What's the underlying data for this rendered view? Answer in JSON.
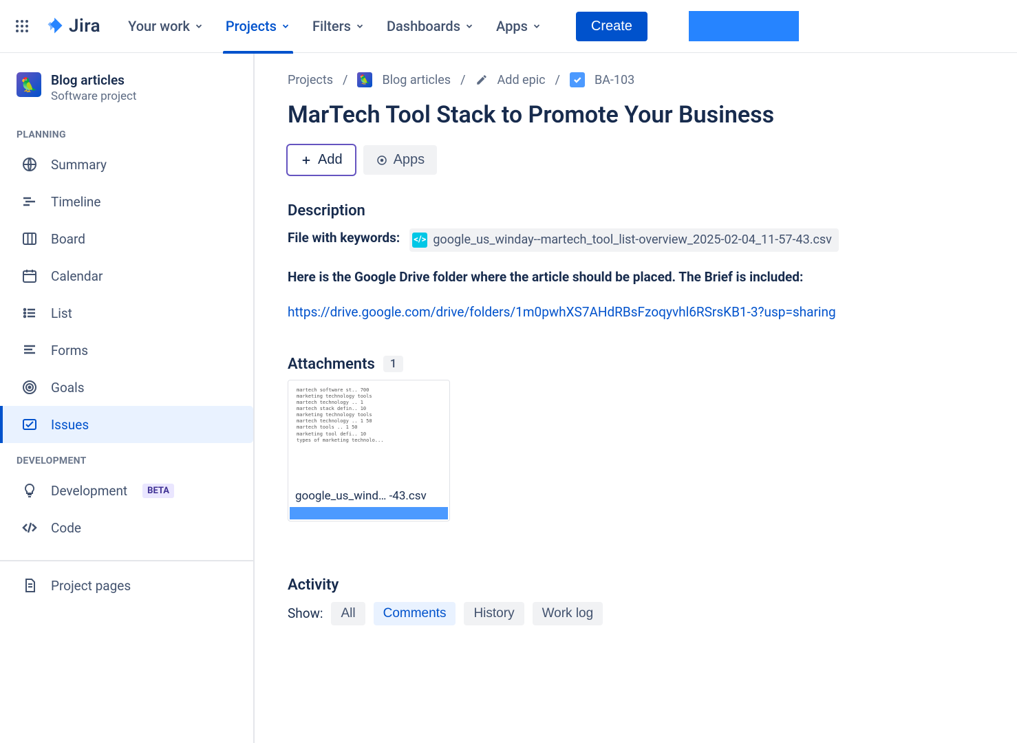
{
  "brand": {
    "name": "Jira"
  },
  "topnav": {
    "items": [
      {
        "label": "Your work"
      },
      {
        "label": "Projects"
      },
      {
        "label": "Filters"
      },
      {
        "label": "Dashboards"
      },
      {
        "label": "Apps"
      }
    ],
    "create": "Create"
  },
  "project": {
    "name": "Blog articles",
    "type": "Software project"
  },
  "sidebar": {
    "sections": {
      "planning": "PLANNING",
      "development": "DEVELOPMENT"
    },
    "planning": [
      {
        "label": "Summary"
      },
      {
        "label": "Timeline"
      },
      {
        "label": "Board"
      },
      {
        "label": "Calendar"
      },
      {
        "label": "List"
      },
      {
        "label": "Forms"
      },
      {
        "label": "Goals"
      },
      {
        "label": "Issues"
      }
    ],
    "development": [
      {
        "label": "Development",
        "badge": "BETA"
      },
      {
        "label": "Code"
      }
    ],
    "project_pages": "Project pages"
  },
  "breadcrumbs": {
    "root": "Projects",
    "project": "Blog articles",
    "epic": "Add epic",
    "key": "BA-103"
  },
  "issue": {
    "title": "MarTech Tool Stack to Promote Your Business",
    "actions": {
      "add": "Add",
      "apps": "Apps"
    }
  },
  "description": {
    "heading": "Description",
    "kw_label": "File with keywords:",
    "kw_file": "google_us_winday--martech_tool_list-overview_2025-02-04_11-57-43.csv",
    "folder_intro": "Here is the Google Drive folder where the article should be placed. The Brief is included:",
    "drive_link": "https://drive.google.com/drive/folders/1m0pwhXS7AHdRBsFzoqyvhl6RSrsKB1-3?usp=sharing"
  },
  "attachments": {
    "heading": "Attachments",
    "count": "1",
    "items": [
      {
        "filename": "google_us_wind… -43.csv"
      }
    ]
  },
  "activity": {
    "heading": "Activity",
    "show_label": "Show:",
    "tabs": [
      {
        "label": "All"
      },
      {
        "label": "Comments"
      },
      {
        "label": "History"
      },
      {
        "label": "Work log"
      }
    ]
  }
}
